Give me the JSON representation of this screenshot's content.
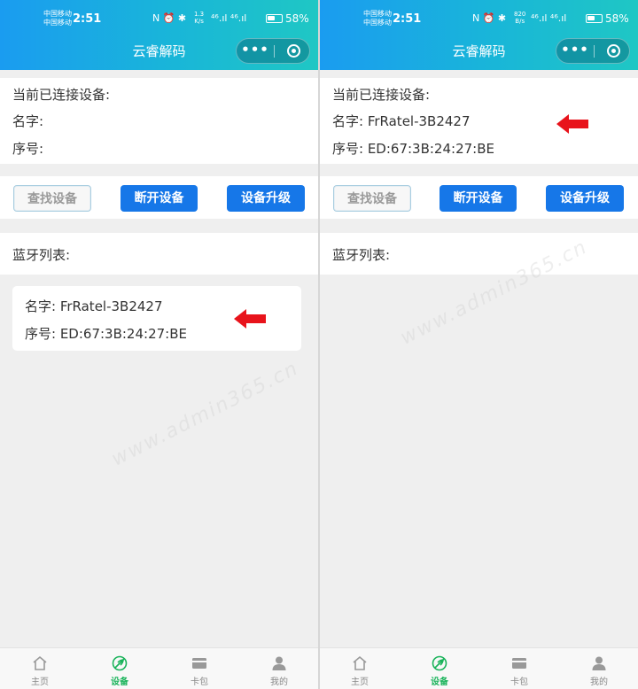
{
  "status_bar": {
    "carrier_line1": "中国移动",
    "carrier_line2": "中国移动",
    "time": "2:51",
    "icons": "N ⏰ ✱ ",
    "left_speed_value": "1.3",
    "left_speed_unit": "K/s",
    "right_speed_value": "820",
    "right_speed_unit": "B/s",
    "network": "⁴⁶.ıl ⁴⁶.ıl",
    "battery_percent": "58%",
    "battery_level": 0.58
  },
  "navbar": {
    "title": "云睿解码",
    "more_label": "•••",
    "more_icon": "more-dots-icon",
    "target_icon": "target-circle-icon"
  },
  "left_screen": {
    "connected": {
      "header": "当前已连接设备:",
      "name_label": "名字:",
      "serial_label": "序号:"
    },
    "actions": {
      "find": "查找设备",
      "disconnect": "断开设备",
      "upgrade": "设备升级"
    },
    "list_title": "蓝牙列表:",
    "devices": [
      {
        "name": "名字: FrRatel-3B2427",
        "serial": "序号: ED:67:3B:24:27:BE"
      }
    ]
  },
  "right_screen": {
    "connected": {
      "header": "当前已连接设备:",
      "name": "名字: FrRatel-3B2427",
      "serial": "序号: ED:67:3B:24:27:BE"
    },
    "actions": {
      "find": "查找设备",
      "disconnect": "断开设备",
      "upgrade": "设备升级"
    },
    "list_title": "蓝牙列表:"
  },
  "tabbar": {
    "items": [
      {
        "label": "主页",
        "icon": "home-icon",
        "active": false
      },
      {
        "label": "设备",
        "icon": "leaf-icon",
        "active": true
      },
      {
        "label": "卡包",
        "icon": "card-icon",
        "active": false
      },
      {
        "label": "我的",
        "icon": "user-icon",
        "active": false
      }
    ]
  },
  "annotation_arrow_color": "#e8131b",
  "accent_color": "#1677e8",
  "active_tab_color": "#19b35a",
  "watermark": "www.admin365.cn"
}
